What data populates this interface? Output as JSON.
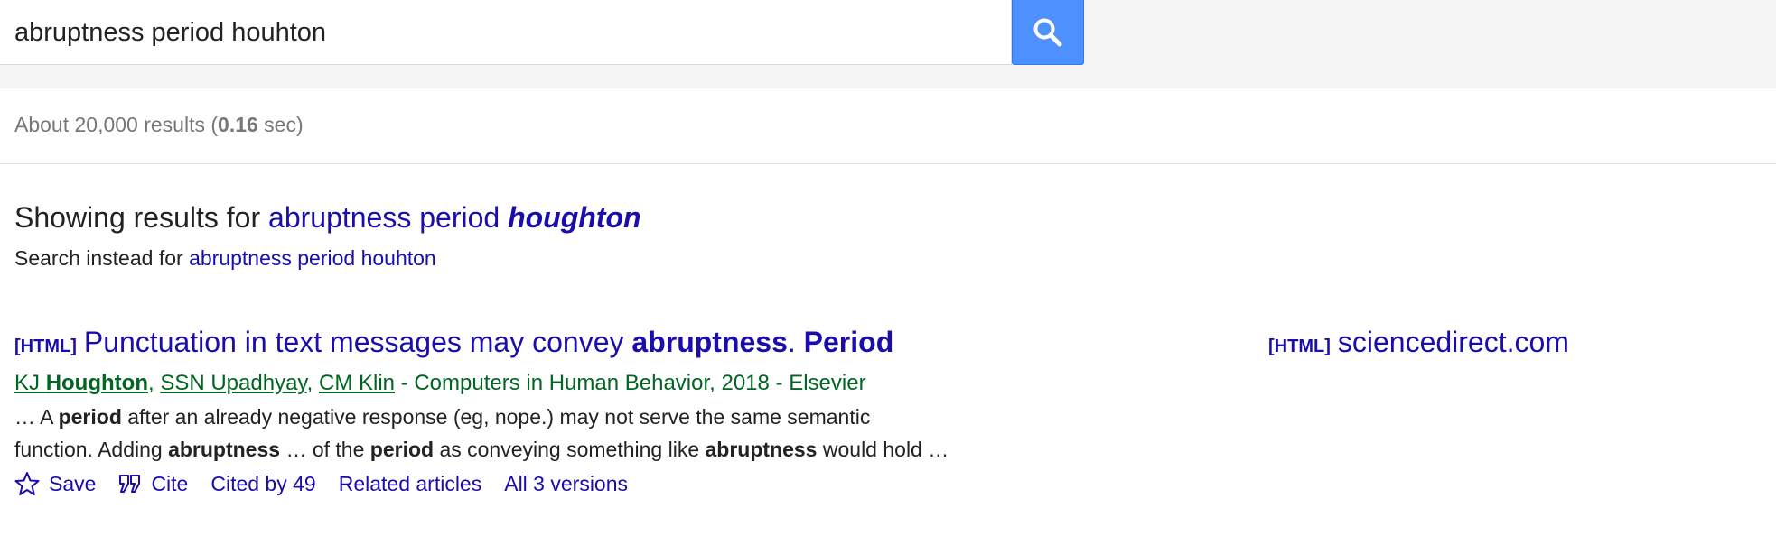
{
  "search": {
    "query": "abruptness period houhton"
  },
  "stats": {
    "prefix": "About 20,000 results (",
    "time": "0.16",
    "suffix": " sec)"
  },
  "spelling": {
    "showing_label": "Showing results for ",
    "corrected_plain": "abruptness period ",
    "corrected_emph": "houghton",
    "instead_label": "Search instead for ",
    "original_query": "abruptness period houhton"
  },
  "results": [
    {
      "tag": "[HTML]",
      "title_parts": [
        "Punctuation in text messages may convey ",
        "abruptness",
        ". ",
        "Period"
      ],
      "authors": [
        {
          "pre": "KJ ",
          "bold": "Houghton"
        },
        {
          "pre": "SSN Upadhyay",
          "bold": ""
        },
        {
          "pre": "CM Klin",
          "bold": ""
        }
      ],
      "author_sep": ", ",
      "source": " - Computers in Human Behavior, 2018 - Elsevier",
      "snippet": {
        "line1": [
          "… A ",
          "period",
          " after an already negative response (eg, nope.) may not serve the same semantic"
        ],
        "line2": [
          "function. Adding ",
          "abruptness",
          " … of the ",
          "period",
          " as conveying something like ",
          "abruptness",
          " would hold …"
        ]
      },
      "actions": {
        "save": "Save",
        "cite": "Cite",
        "cited_by": "Cited by 49",
        "related": "Related articles",
        "versions": "All 3 versions"
      },
      "side": {
        "tag": "[HTML]",
        "domain": "sciencedirect.com"
      }
    }
  ],
  "colors": {
    "link": "#1a0dab",
    "meta_green": "#006621",
    "search_button": "#4d90fe"
  },
  "icons": {
    "search_button": "magnifier-icon",
    "save": "star-icon",
    "cite": "quote-icon"
  }
}
